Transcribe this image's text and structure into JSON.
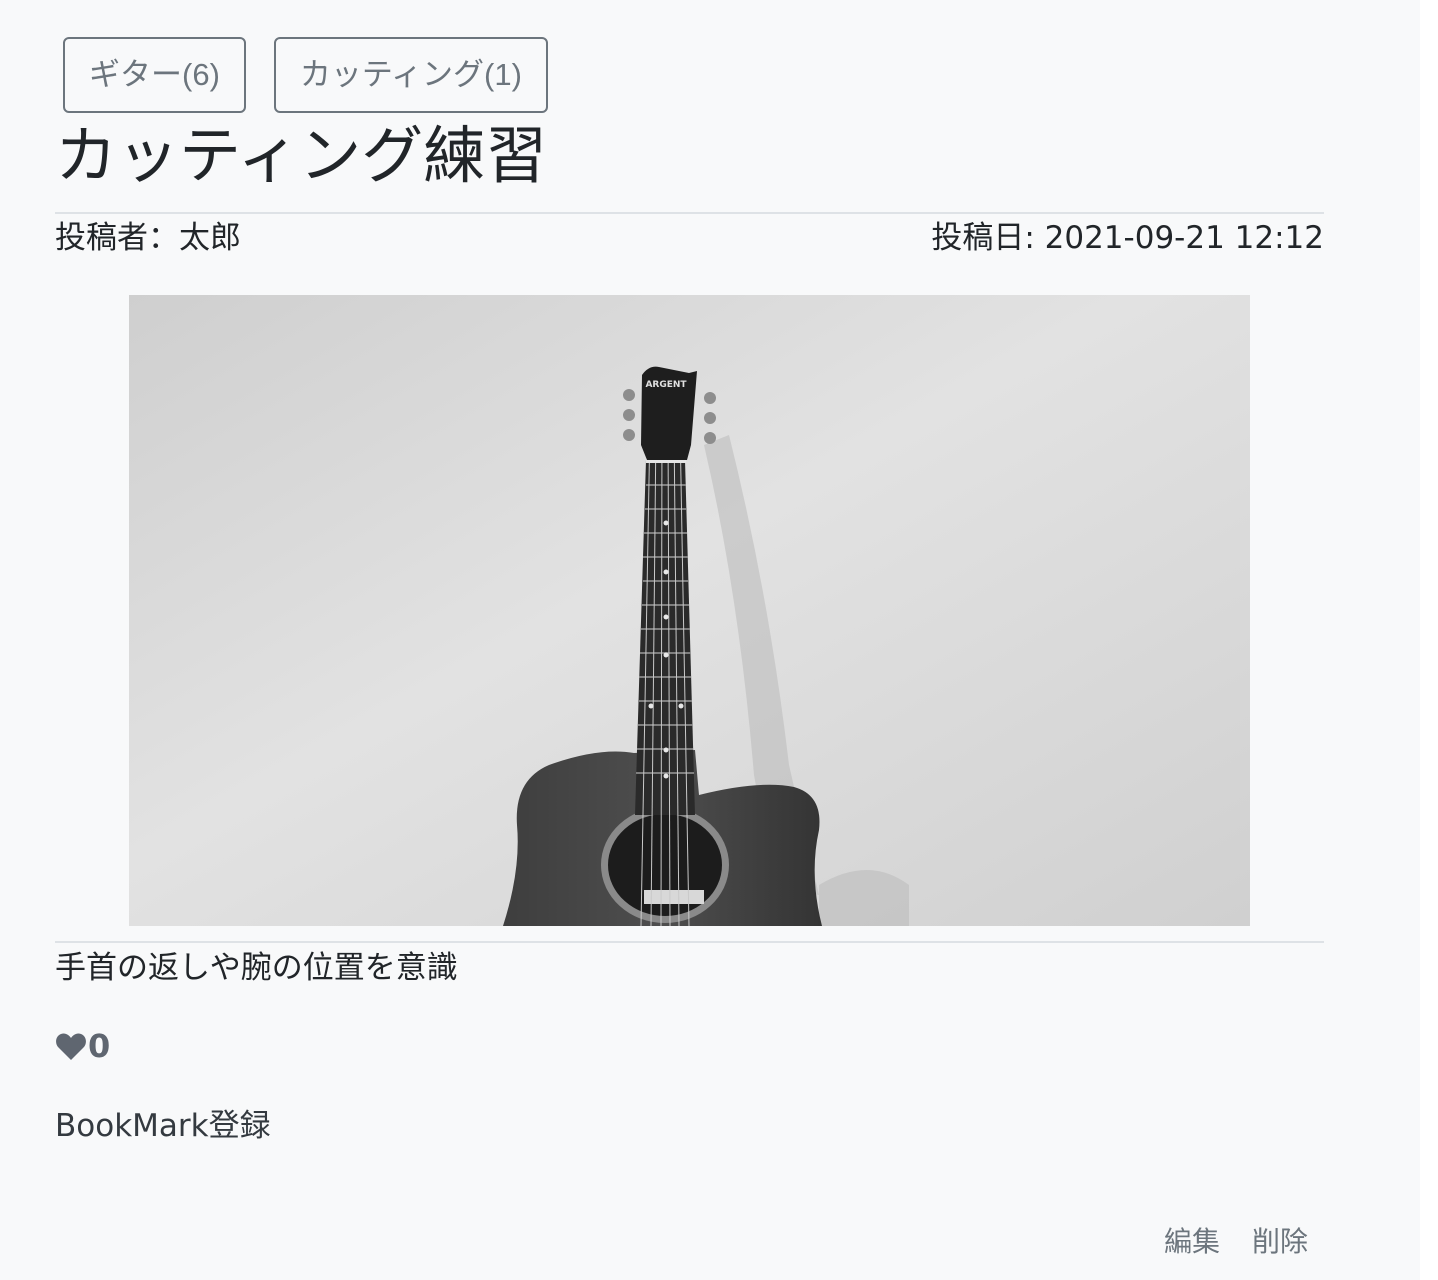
{
  "tags": [
    {
      "label": "ギター(6)"
    },
    {
      "label": "カッティング(1)"
    }
  ],
  "post": {
    "title": "カッティング練習",
    "author": "投稿者：太郎",
    "date": "投稿日: 2021-09-21 12:12",
    "body": "手首の返しや腕の位置を意識",
    "image": {
      "subject": "acoustic guitar leaning against a wall (black and white photo)",
      "headstock_text": "ARGENT"
    }
  },
  "like": {
    "icon": "heart-icon",
    "count": "0"
  },
  "bookmark_label": "BookMark登録",
  "actions": {
    "edit_label": "編集",
    "delete_label": "削除"
  },
  "colors": {
    "background": "#f8f9fa",
    "tag_border": "#6c757d",
    "text": "#212529",
    "muted": "#6c757d"
  }
}
